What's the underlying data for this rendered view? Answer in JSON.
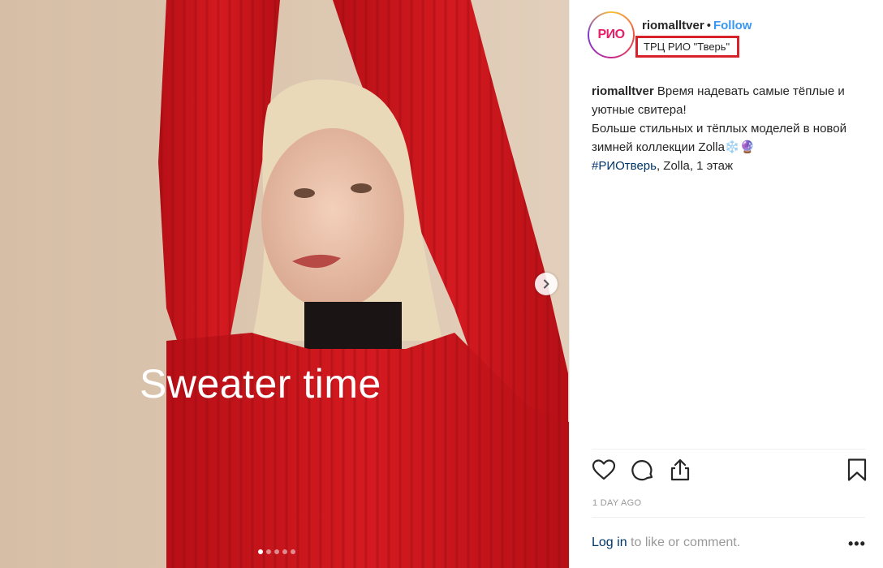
{
  "post": {
    "overlay_text": "Sweater time",
    "carousel": {
      "slide_count": 5,
      "active_slide": 1
    }
  },
  "header": {
    "avatar_logo": "РИО",
    "username": "riomalltver",
    "separator": "•",
    "follow_label": "Follow",
    "location": "ТРЦ РИО \"Тверь\""
  },
  "caption": {
    "username": "riomalltver",
    "text_1": "Время надевать самые тёплые и уютные свитера!",
    "text_2": "Больше стильных и тёплых моделей в новой зимней коллекции Zolla❄️🔮",
    "hashtag": "#РИОтверь",
    "text_3": ", Zolla, 1 этаж"
  },
  "actions": {
    "like_icon": "heart-icon",
    "comment_icon": "comment-icon",
    "share_icon": "share-icon",
    "save_icon": "bookmark-icon"
  },
  "timestamp": "1 DAY AGO",
  "footer": {
    "login_label": "Log in",
    "login_suffix": " to like or comment.",
    "more_label": "•••"
  },
  "colors": {
    "follow": "#3897f0",
    "hashtag": "#003569",
    "highlight_box": "#d8222a",
    "sweater": "#c8141b",
    "background": "#d9c3ac"
  }
}
